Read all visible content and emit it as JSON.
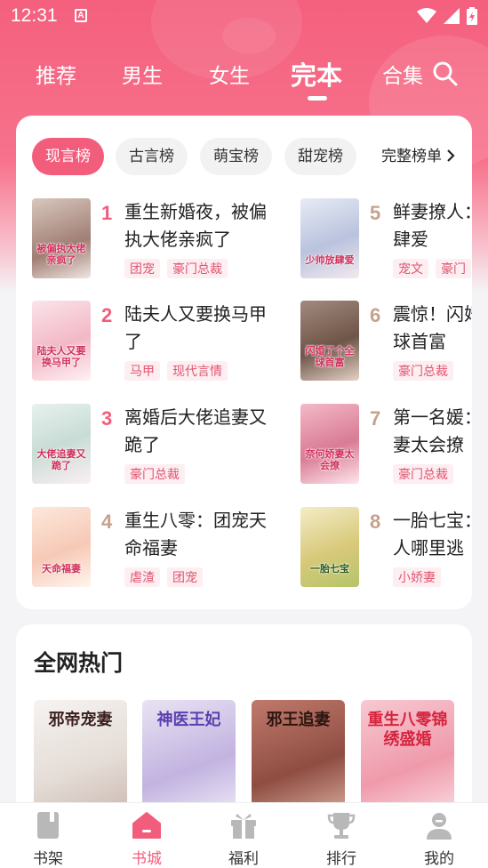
{
  "status_bar": {
    "time": "12:31",
    "notification_badge": "A"
  },
  "top_tabs": [
    {
      "label": "推荐",
      "active": false
    },
    {
      "label": "男生",
      "active": false
    },
    {
      "label": "女生",
      "active": false
    },
    {
      "label": "完本",
      "active": true
    },
    {
      "label": "合集",
      "active": false
    }
  ],
  "rank_filters": {
    "pills": [
      {
        "label": "现言榜",
        "active": true
      },
      {
        "label": "古言榜",
        "active": false
      },
      {
        "label": "萌宝榜",
        "active": false
      },
      {
        "label": "甜宠榜",
        "active": false
      }
    ],
    "more_label": "完整榜单"
  },
  "rank_books": [
    {
      "rank": "1",
      "title": "重生新婚夜，被偏执大佬亲疯了",
      "tags": [
        "团宠",
        "豪门总裁"
      ],
      "cover_text": "被偏执大佬亲疯了",
      "rank_color": "#f35d7c"
    },
    {
      "rank": "2",
      "title": "陆夫人又要换马甲了",
      "tags": [
        "马甲",
        "现代言情"
      ],
      "cover_text": "陆夫人又要换马甲了",
      "rank_color": "#f35d7c"
    },
    {
      "rank": "3",
      "title": "离婚后大佬追妻又跪了",
      "tags": [
        "豪门总裁"
      ],
      "cover_text": "大佬追妻又跪了",
      "rank_color": "#f35d7c"
    },
    {
      "rank": "4",
      "title": "重生八零：团宠天命福妻",
      "tags": [
        "虐渣",
        "团宠"
      ],
      "cover_text": "天命福妻",
      "rank_color": "#c8a08c"
    },
    {
      "rank": "5",
      "title": "鲜妻撩人：少帅放肆爱",
      "tags": [
        "宠文",
        "豪门"
      ],
      "cover_text": "少帅放肆爱",
      "rank_color": "#c8a08c"
    },
    {
      "rank": "6",
      "title": "震惊！闪婚了个全球首富",
      "tags": [
        "豪门总裁"
      ],
      "cover_text": "闪婚了个全球首富",
      "rank_color": "#c8a08c"
    },
    {
      "rank": "7",
      "title": "第一名媛：大佬娇妻太会撩",
      "tags": [
        "豪门总裁"
      ],
      "cover_text": "奈何娇妻太会撩",
      "rank_color": "#c8a08c"
    },
    {
      "rank": "8",
      "title": "一胎七宝：总裁大人哪里逃",
      "tags": [
        "小娇妻"
      ],
      "cover_text": "一胎七宝",
      "rank_color": "#c8a08c"
    }
  ],
  "hot_section": {
    "title": "全网热门",
    "books": [
      {
        "cover_text": "邪帝宠妻"
      },
      {
        "cover_text": "神医王妃"
      },
      {
        "cover_text": "邪王追妻"
      },
      {
        "cover_text": "重生八零锦绣盛婚"
      }
    ]
  },
  "bottom_nav": [
    {
      "label": "书架",
      "icon": "bookshelf-icon",
      "active": false
    },
    {
      "label": "书城",
      "icon": "store-icon",
      "active": true
    },
    {
      "label": "福利",
      "icon": "gift-icon",
      "active": false
    },
    {
      "label": "排行",
      "icon": "trophy-icon",
      "active": false
    },
    {
      "label": "我的",
      "icon": "profile-icon",
      "active": false
    }
  ],
  "colors": {
    "accent": "#f35d7c",
    "hero_top": "#f4607e",
    "tag_bg": "#fdeef2",
    "tag_text": "#e1546f"
  }
}
